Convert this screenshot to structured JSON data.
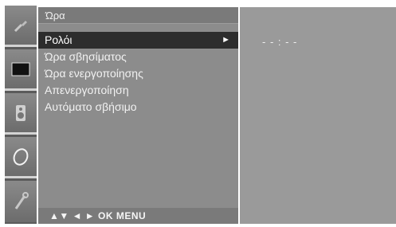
{
  "sidebar": {
    "icons": [
      "tools-icon",
      "picture-icon",
      "audio-icon",
      "time-icon",
      "options-icon"
    ]
  },
  "menu": {
    "title": "Ώρα",
    "items": [
      {
        "label": "Ρολόι",
        "selected": true,
        "arrow": "►"
      },
      {
        "label": "Ώρα σβησίματος"
      },
      {
        "label": "Ώρα ενεργοποίησης"
      },
      {
        "label": "Απενεργοποίηση"
      },
      {
        "label": "Αυτόματο σβήσιμο"
      }
    ],
    "footer": "▲▼ ◄ ► OK MENU"
  },
  "value_panel": {
    "time_value": "- - : - -"
  },
  "colors": {
    "sidebar": "#5b5b5b",
    "menu_bg": "#8c8c8c",
    "selected_bg": "#2d2d2d",
    "value_bg": "#9a9a9a"
  }
}
